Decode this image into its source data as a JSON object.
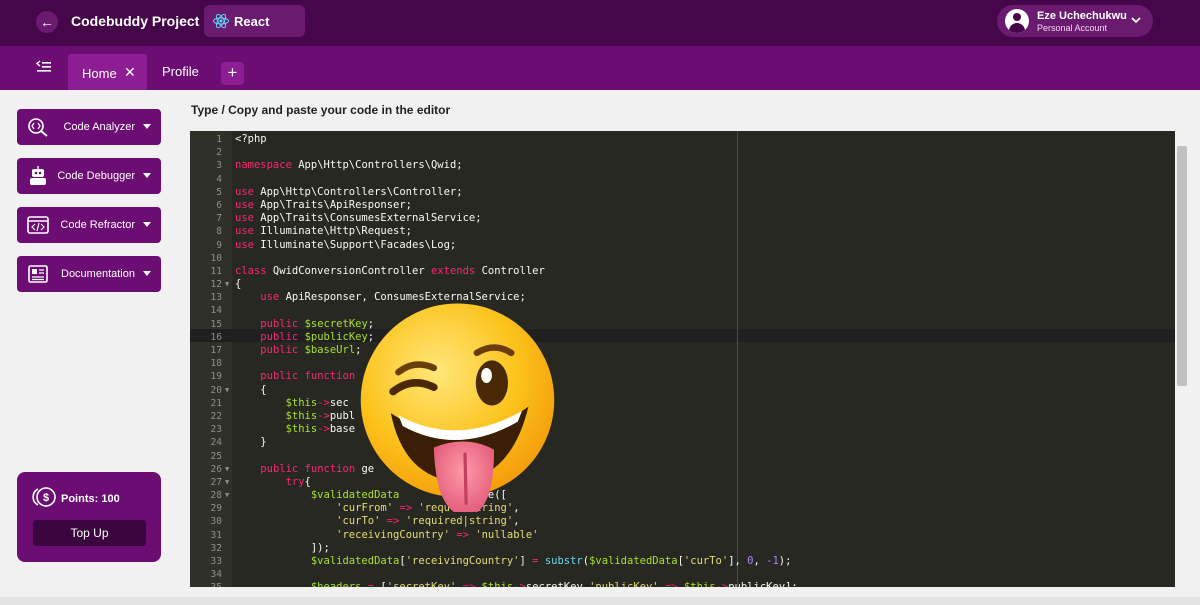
{
  "header": {
    "project_title": "Codebuddy Project",
    "framework": "React",
    "user": {
      "name": "Eze Uchechukwu",
      "account_type": "Personal Account"
    }
  },
  "tabs": [
    {
      "label": "Home",
      "active": true,
      "close_glyph": "✕"
    },
    {
      "label": "Profile",
      "active": false
    }
  ],
  "add_tab_glyph": "+",
  "sidebar": {
    "tools": [
      {
        "label": "Code Analyzer",
        "icon": "search-code-icon"
      },
      {
        "label": "Code Debugger",
        "icon": "robot-icon"
      },
      {
        "label": "Code Refractor",
        "icon": "code-window-icon"
      },
      {
        "label": "Documentation",
        "icon": "document-icon"
      }
    ],
    "points": {
      "label": "Points: 100",
      "value": 100,
      "icon": "coins-icon"
    },
    "top_up_label": "Top Up"
  },
  "editor": {
    "instruction": "Type / Copy and paste your code in the editor",
    "lines": [
      {
        "n": "1",
        "code": "<?php"
      },
      {
        "n": "2",
        "code": ""
      },
      {
        "n": "3",
        "code": "namespace App\\Http\\Controllers\\Qwid;"
      },
      {
        "n": "4",
        "code": ""
      },
      {
        "n": "5",
        "code": "use App\\Http\\Controllers\\Controller;"
      },
      {
        "n": "6",
        "code": "use App\\Traits\\ApiResponser;"
      },
      {
        "n": "7",
        "code": "use App\\Traits\\ConsumesExternalService;"
      },
      {
        "n": "8",
        "code": "use Illuminate\\Http\\Request;"
      },
      {
        "n": "9",
        "code": "use Illuminate\\Support\\Facades\\Log;"
      },
      {
        "n": "10",
        "code": ""
      },
      {
        "n": "11",
        "code": "class QwidConversionController extends Controller"
      },
      {
        "n": "12",
        "code": "{",
        "fold": true
      },
      {
        "n": "13",
        "code": "    use ApiResponser, ConsumesExternalService;"
      },
      {
        "n": "14",
        "code": ""
      },
      {
        "n": "15",
        "code": "    public $secretKey;"
      },
      {
        "n": "16",
        "code": "    public $publicKey;"
      },
      {
        "n": "17",
        "code": "    public $baseUrl;"
      },
      {
        "n": "18",
        "code": ""
      },
      {
        "n": "19",
        "code": "    public function"
      },
      {
        "n": "20",
        "code": "    {",
        "fold": true
      },
      {
        "n": "21",
        "code": "        $this->sec                  EY');"
      },
      {
        "n": "22",
        "code": "        $this->publ                 EY');"
      },
      {
        "n": "23",
        "code": "        $this->base                  _URL');"
      },
      {
        "n": "24",
        "code": "    }"
      },
      {
        "n": "25",
        "code": ""
      },
      {
        "n": "26",
        "code": "    public function ge                    ){",
        "fold": true
      },
      {
        "n": "27",
        "code": "        try{",
        "fold": true
      },
      {
        "n": "28",
        "code": "            $validatedData           date([",
        "fold": true
      },
      {
        "n": "29",
        "code": "                'curFrom' => 'requ    tring',"
      },
      {
        "n": "30",
        "code": "                'curTo' => 'required|string',"
      },
      {
        "n": "31",
        "code": "                'receivingCountry' => 'nullable'"
      },
      {
        "n": "32",
        "code": "            ]);"
      },
      {
        "n": "33",
        "code": "            $validatedData['receivingCountry'] = substr($validatedData['curTo'], 0, -1);"
      },
      {
        "n": "34",
        "code": ""
      },
      {
        "n": "35",
        "code": "            $headers = ['secretKey' => $this->secretKey,'publicKey' => $this->publicKey];"
      }
    ]
  },
  "overlay": {
    "icon": "winking-face-tongue-emoji-icon"
  },
  "colors": {
    "header_bg": "#45074a",
    "tabbar_bg": "#6b0d72",
    "editor_bg": "#272822"
  }
}
